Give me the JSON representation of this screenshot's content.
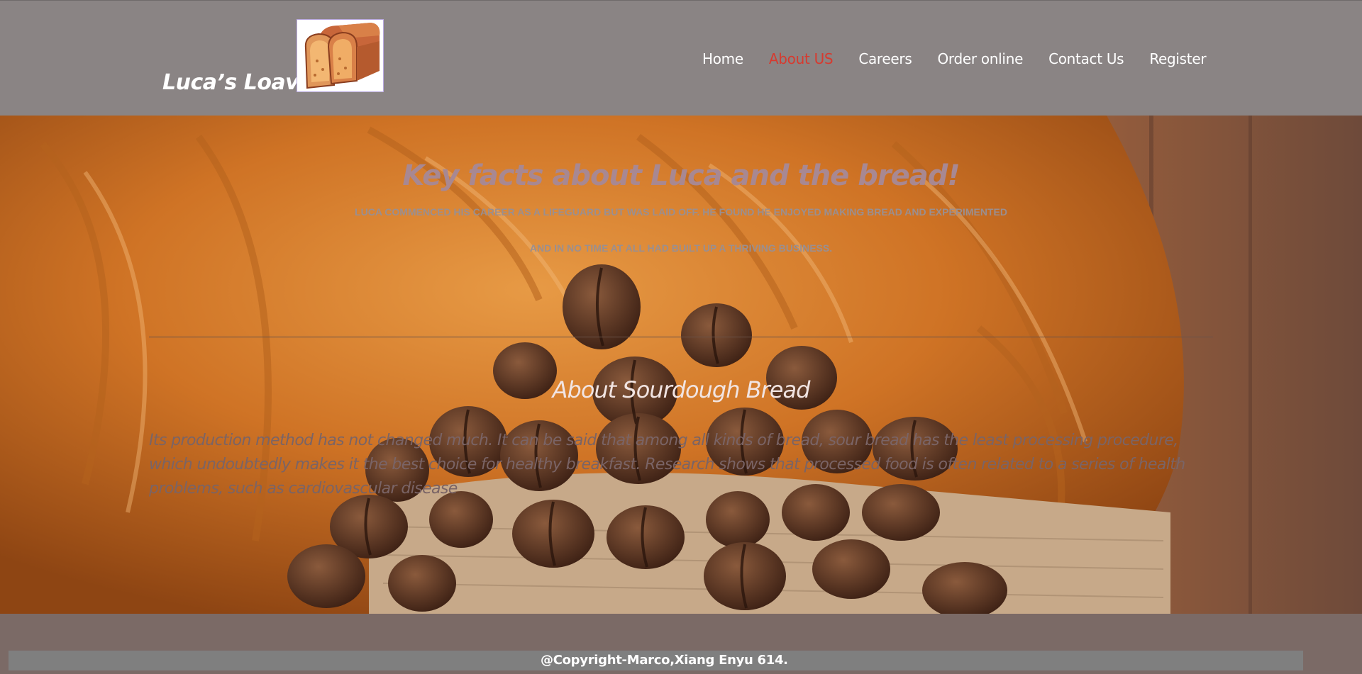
{
  "header": {
    "brand": "Luca’s Loaves",
    "logo_icon": "bread-loaf-icon",
    "nav": [
      {
        "label": "Home",
        "active": false
      },
      {
        "label": "About US",
        "active": true
      },
      {
        "label": "Careers",
        "active": false
      },
      {
        "label": "Order online",
        "active": false
      },
      {
        "label": "Contact Us",
        "active": false
      },
      {
        "label": "Register",
        "active": false
      }
    ],
    "active_color": "#d73a2f"
  },
  "hero": {
    "background": "croissant-and-coffee-beans-photo",
    "title": "Key facts about Luca and the bread!",
    "line1": "LUCA COMMENCED HIS CAREER AS A LIFEGUARD BUT WAS LAID OFF. HE FOUND HE ENJOYED MAKING BREAD AND EXPERIMENTED",
    "line2": "AND IN NO TIME AT ALL HAD BUILT UP A THRIVING BUSINESS."
  },
  "sourdough": {
    "title": "About Sourdough Bread",
    "text": "Its production method has not changed much. It can be said that among all kinds of bread, sour bread has the least processing procedure, which undoubtedly makes it the best choice for healthy breakfast. Research shows that processed food is often related to a series of health problems, such as cardiovascular disease"
  },
  "footer": {
    "copyright": "@Copyright-Marco,Xiang Enyu 614."
  }
}
